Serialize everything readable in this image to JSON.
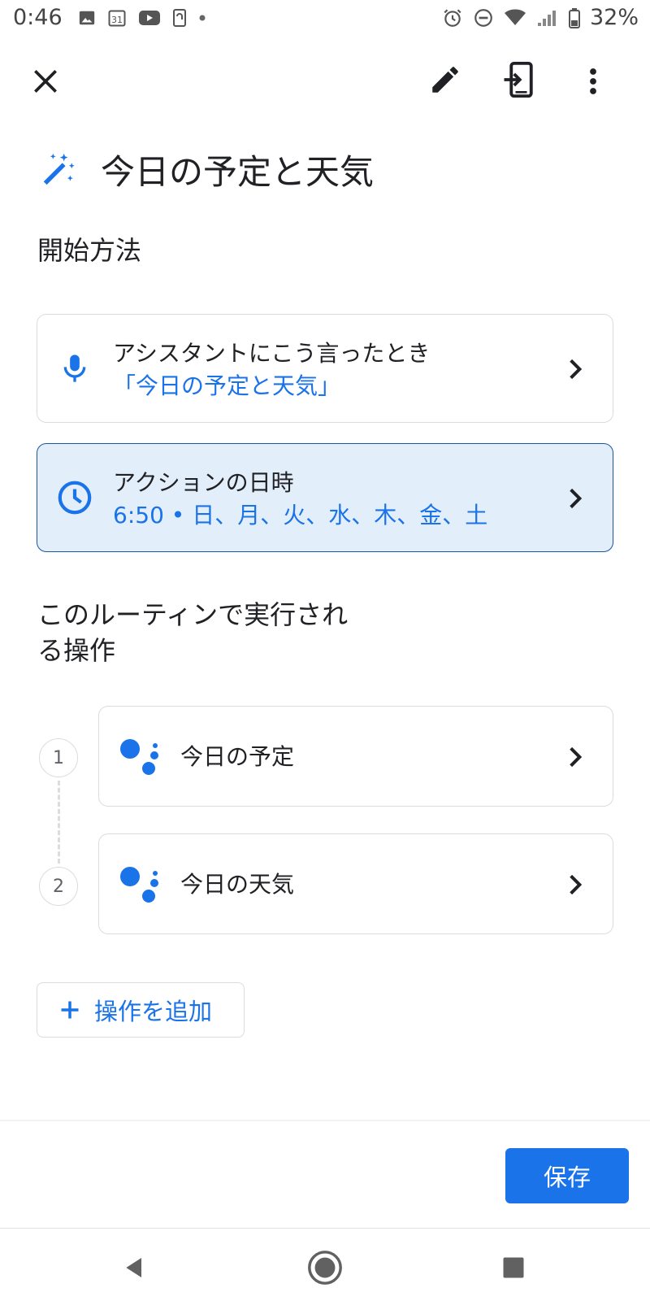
{
  "status_bar": {
    "time": "0:46",
    "calendar_day": "31",
    "battery_percent": "32%",
    "left_icons": [
      "image-icon",
      "calendar-icon",
      "youtube-icon",
      "nfc-icon",
      "dot-icon"
    ],
    "right_icons": [
      "alarm-icon",
      "do-not-disturb-icon",
      "wifi-icon",
      "signal-icon",
      "battery-icon"
    ]
  },
  "toolbar": {
    "icons": [
      "close-icon",
      "edit-pencil-icon",
      "send-to-device-icon",
      "more-vert-icon"
    ]
  },
  "routine": {
    "title": "今日の予定と天気",
    "title_icon": "magic-wand-icon"
  },
  "start_section": {
    "heading": "開始方法",
    "voice_card": {
      "icon": "microphone-icon",
      "line1": "アシスタントにこう言ったとき",
      "line2": "「今日の予定と天気」"
    },
    "time_card": {
      "icon": "clock-icon",
      "line1": "アクションの日時",
      "line2": "6:50 • 日、月、火、水、木、金、土",
      "selected": true
    }
  },
  "actions_section": {
    "heading_line1": "このルーティンで実行され",
    "heading_line2": "る操作",
    "actions": [
      {
        "step": "1",
        "label": "今日の予定",
        "icon": "google-assistant-icon"
      },
      {
        "step": "2",
        "label": "今日の天気",
        "icon": "google-assistant-icon"
      }
    ],
    "add_action_label": "操作を追加"
  },
  "footer": {
    "save_label": "保存"
  },
  "navigation": {
    "icons": [
      "back-triangle-icon",
      "home-circle-icon",
      "recents-square-icon"
    ]
  },
  "colors": {
    "accent": "#1a73e8",
    "selected_card_bg": "#e3eefb",
    "selected_card_border": "#1a56a0",
    "text_primary": "#202124",
    "border": "#dadce0"
  }
}
